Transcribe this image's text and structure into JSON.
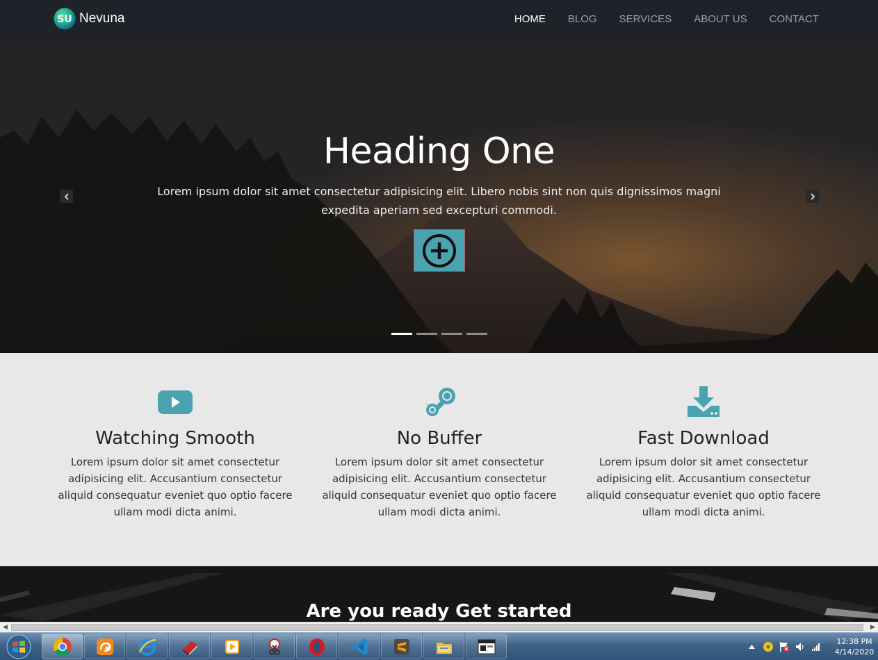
{
  "navbar": {
    "brand": "Nevuna",
    "brand_logo_text": "SU",
    "links": [
      {
        "label": "HOME",
        "active": true
      },
      {
        "label": "BLOG",
        "active": false
      },
      {
        "label": "SERVICES",
        "active": false
      },
      {
        "label": "ABOUT US",
        "active": false
      },
      {
        "label": "CONTACT",
        "active": false
      }
    ]
  },
  "hero": {
    "heading": "Heading One",
    "text": "Lorem ipsum dolor sit amet consectetur adipisicing elit. Libero nobis sint non quis dignissimos magni expedita aperiam sed excepturi commodi.",
    "cta_icon": "plus-circle-icon",
    "slide_count": 4,
    "active_slide": 1
  },
  "features": [
    {
      "icon": "youtube-icon",
      "title": "Watching Smooth",
      "text": "Lorem ipsum dolor sit amet consectetur adipisicing elit. Accusantium consectetur aliquid consequatur eveniet quo optio facere ullam modi dicta animi."
    },
    {
      "icon": "steam-icon",
      "title": "No Buffer",
      "text": "Lorem ipsum dolor sit amet consectetur adipisicing elit. Accusantium consectetur aliquid consequatur eveniet quo optio facere ullam modi dicta animi."
    },
    {
      "icon": "download-icon",
      "title": "Fast Download",
      "text": "Lorem ipsum dolor sit amet consectetur adipisicing elit. Accusantium consectetur aliquid consequatur eveniet quo optio facere ullam modi dicta animi."
    }
  ],
  "get_started": {
    "heading": "Are you ready Get started"
  },
  "taskbar": {
    "apps": [
      "chrome-icon",
      "uc-browser-icon",
      "internet-explorer-icon",
      "book-app-icon",
      "media-player-icon",
      "snipping-tool-icon",
      "opera-icon",
      "vscode-icon",
      "sublime-text-icon",
      "file-explorer-icon",
      "terminal-window-icon"
    ],
    "active_app": "chrome-icon",
    "clock_time": "12:38 PM",
    "clock_date": "4/14/2020"
  },
  "colors": {
    "accent": "#4aa3b0",
    "navbar_bg": "#1f2329",
    "features_bg": "#e8e8e8"
  }
}
